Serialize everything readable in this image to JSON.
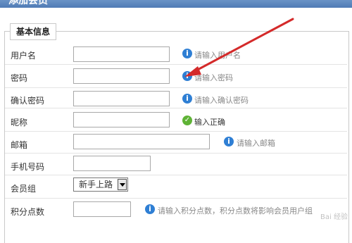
{
  "window": {
    "title": "添加会员"
  },
  "section": {
    "legend": "基本信息"
  },
  "fields": {
    "username": {
      "label": "用户名",
      "value": "",
      "hint": "请输入用户名"
    },
    "password": {
      "label": "密码",
      "value": "",
      "hint": "请输入密码"
    },
    "confirm_password": {
      "label": "确认密码",
      "value": "",
      "hint": "请输入确认密码"
    },
    "nickname": {
      "label": "昵称",
      "value": "",
      "hint": "输入正确"
    },
    "email": {
      "label": "邮箱",
      "value": "",
      "hint": "请输入邮箱"
    },
    "phone": {
      "label": "手机号码",
      "value": ""
    },
    "member_group": {
      "label": "会员组",
      "selected": "新手上路"
    },
    "points": {
      "label": "积分点数",
      "value": "",
      "hint": "请输入积分点数，积分点数将影响会员用户组"
    }
  },
  "icons": {
    "info": "info-icon",
    "valid": "check-icon",
    "annotation": "red-arrow"
  },
  "colors": {
    "arrow": "#d42a2a",
    "info": "#2f7fd4",
    "valid": "#5fb336",
    "titlebar": "#5a86bf"
  }
}
